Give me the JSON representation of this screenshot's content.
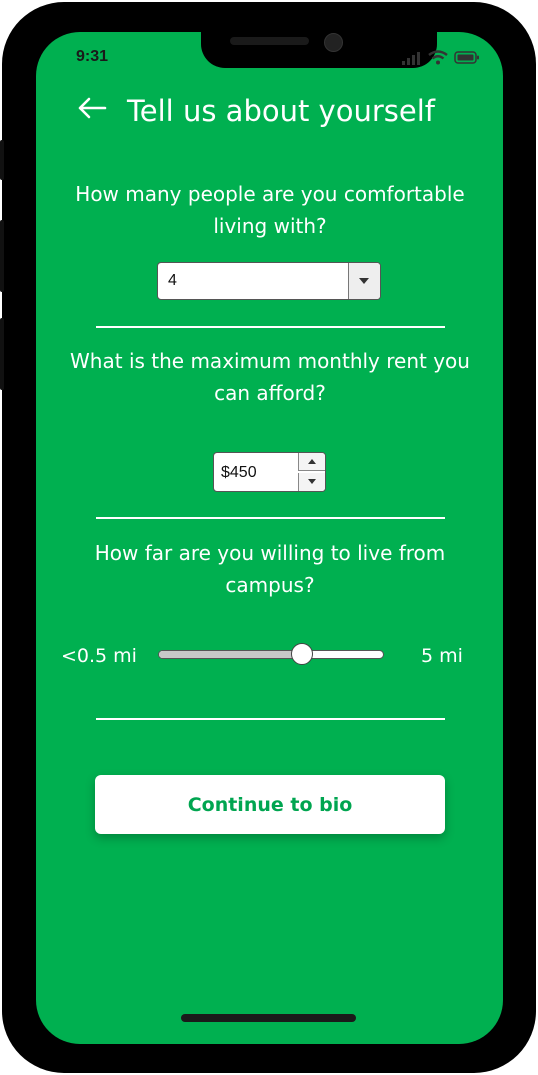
{
  "status_bar": {
    "time": "9:31",
    "icons": [
      "signal-icon",
      "wifi-icon",
      "battery-icon"
    ]
  },
  "header": {
    "title": "Tell us about yourself",
    "back_icon": "back-arrow-icon"
  },
  "roommates": {
    "question": "How many people are you comfortable living with?",
    "selected": "4"
  },
  "rent": {
    "question": "What is the maximum monthly rent you can afford?",
    "value": "$450"
  },
  "distance": {
    "question": "How far are you willing to live from campus?",
    "min_label": "<0.5 mi",
    "max_label": "5 mi",
    "level": 0.65
  },
  "continue_button": {
    "label": "Continue to bio"
  },
  "colors": {
    "accent": "#00b050",
    "button_text": "#00a550"
  }
}
